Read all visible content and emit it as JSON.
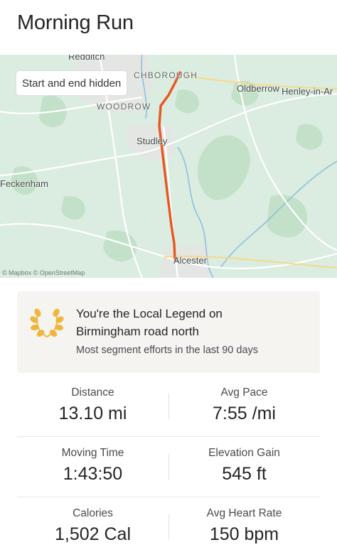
{
  "activity": {
    "title": "Morning Run"
  },
  "map": {
    "privacy_label": "Start and end hidden",
    "attribution": "© Mapbox © OpenStreetMap",
    "places": [
      "Redditch",
      "CHBOROUGH",
      "WOODROW",
      "Studley",
      "Oldberrow",
      "Henley-in-Ar",
      "Feckenham",
      "Alcester"
    ],
    "route_color": "#e8561f"
  },
  "local_legend": {
    "icon": "laurel-wreath-icon",
    "headline_line1": "You're the Local Legend on",
    "headline_line2": "Birmingham road north",
    "subtitle": "Most segment efforts in the last 90 days"
  },
  "stats": [
    {
      "label": "Distance",
      "value": "13.10 mi"
    },
    {
      "label": "Avg Pace",
      "value": "7:55 /mi"
    },
    {
      "label": "Moving Time",
      "value": "1:43:50"
    },
    {
      "label": "Elevation Gain",
      "value": "545 ft"
    },
    {
      "label": "Calories",
      "value": "1,502 Cal"
    },
    {
      "label": "Avg Heart Rate",
      "value": "150 bpm"
    }
  ]
}
